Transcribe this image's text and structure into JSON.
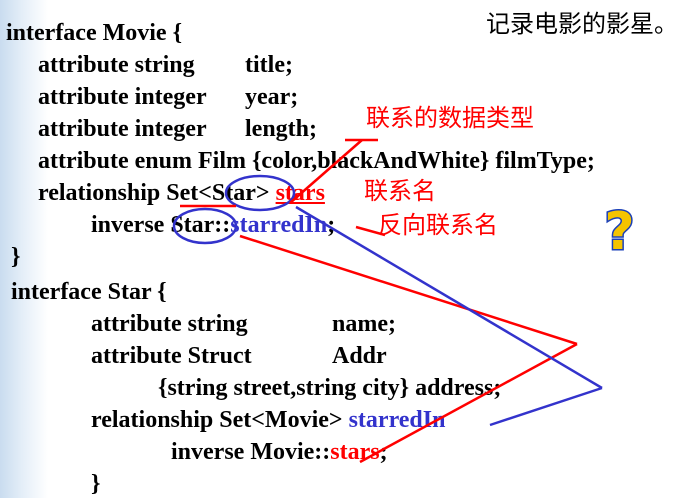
{
  "slide": {
    "heading_note": "记录电影的影星。",
    "code": {
      "l1": "interface Movie {",
      "l2a": "attribute string",
      "l2b": "title;",
      "l3a": "attribute integer",
      "l3b": "year;",
      "l4a": "attribute integer",
      "l4b": "length;",
      "l5": "attribute enum Film {color,blackAndWhite} filmType;",
      "l6a": "relationship Set<Star>",
      "l6b": "stars",
      "l7a": "inverse Star::",
      "l7b": "starredIn",
      "l7c": ";",
      "l8": "}",
      "l9": "interface Star {",
      "l10a": "attribute string",
      "l10b": "name;",
      "l11a": "attribute Struct",
      "l11b": "Addr",
      "l12": "{string street,string city} address;",
      "l13a": "relationship Set<Movie>",
      "l13b": "starredIn",
      "l14a": "inverse Movie::",
      "l14b": "stars",
      "l14c": ";",
      "l15": "}"
    },
    "annotations": {
      "data_type": "联系的数据类型",
      "rel_name": "联系名",
      "inverse_name": "反向联系名"
    },
    "icon": "question-mark-icon"
  },
  "colors": {
    "red": "#ff0000",
    "blue": "#3333cc"
  }
}
